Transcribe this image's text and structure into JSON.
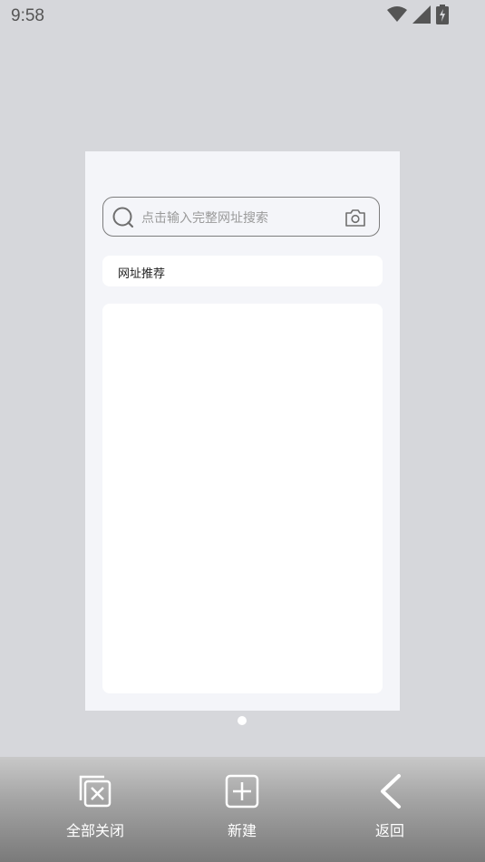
{
  "status_bar": {
    "time": "9:58",
    "icons": [
      "wifi-icon",
      "cellular-signal-icon",
      "battery-charging-icon"
    ]
  },
  "tab_preview": {
    "search": {
      "placeholder": "点击输入完整网址搜索",
      "left_icon": "search-icon",
      "right_icon": "camera-icon"
    },
    "recommend_label": "网址推荐"
  },
  "pager": {
    "current_page": 1,
    "total_pages": 1
  },
  "bottom_bar": {
    "close_all_label": "全部关闭",
    "new_label": "新建",
    "back_label": "返回"
  },
  "colors": {
    "background": "#d6d7db",
    "card_background": "#f4f5f9",
    "toolbar_text": "#ffffff"
  }
}
